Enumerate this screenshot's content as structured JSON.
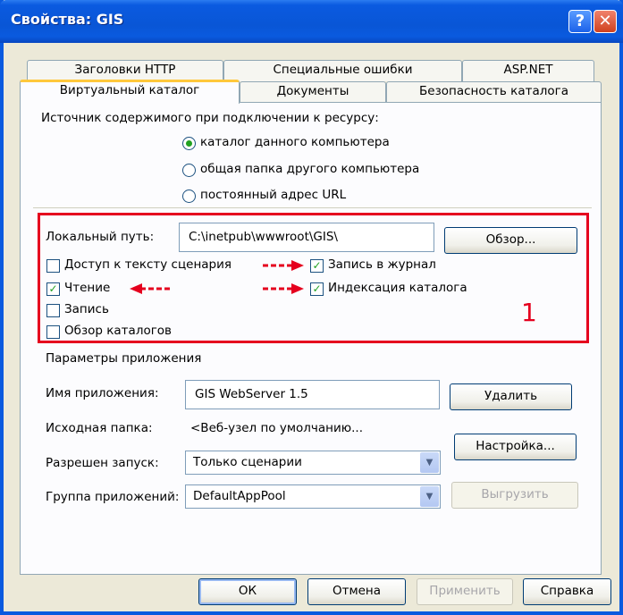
{
  "window": {
    "title": "Свойства: GIS"
  },
  "titlebar_buttons": {
    "help": "?",
    "close": "✕"
  },
  "tabs_back": [
    "Заголовки HTTP",
    "Специальные ошибки",
    "ASP.NET"
  ],
  "tabs_front": [
    "Виртуальный каталог",
    "Документы",
    "Безопасность каталога"
  ],
  "source": {
    "label": "Источник содержимого при подключении к ресурсу:",
    "options": [
      "каталог данного компьютера",
      "общая папка другого компьютера",
      "постоянный адрес URL"
    ],
    "selected_index": 0
  },
  "local_path": {
    "label": "Локальный путь:",
    "value": "C:\\inetpub\\wwwroot\\GIS\\",
    "browse": "Обзор..."
  },
  "checkboxes": [
    {
      "label": "Доступ к тексту сценария",
      "checked": false
    },
    {
      "label": "Чтение",
      "checked": true
    },
    {
      "label": "Запись",
      "checked": false
    },
    {
      "label": "Обзор каталогов",
      "checked": false
    },
    {
      "label": "Запись в журнал",
      "checked": true
    },
    {
      "label": "Индексация каталога",
      "checked": true
    }
  ],
  "annotation": {
    "number": "1",
    "color": "#e5001e"
  },
  "app": {
    "section": "Параметры приложения",
    "name_label": "Имя приложения:",
    "name_value": "GIS WebServer 1.5",
    "delete": "Удалить",
    "folder_label": "Исходная папка:",
    "folder_value": "<Веб-узел по умолчанию...",
    "config": "Настройка...",
    "exec_label": "Разрешен запуск:",
    "exec_value": "Только сценарии",
    "pool_label": "Группа приложений:",
    "pool_value": "DefaultAppPool",
    "unload": "Выгрузить"
  },
  "footer": {
    "ok": "ОК",
    "cancel": "Отмена",
    "apply": "Применить",
    "help": "Справка"
  },
  "colors": {
    "titlebar": "#0a5adf",
    "tab_highlight": "#ffc83c",
    "check": "#21a121"
  }
}
